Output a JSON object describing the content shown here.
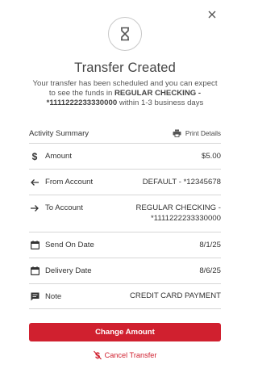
{
  "dialog": {
    "title": "Transfer Created",
    "desc_pre": "Your transfer has been scheduled and you can expect to see the funds in ",
    "desc_account": "REGULAR CHECKING - *1111222233330000",
    "desc_post": " within 1-3 business days"
  },
  "summary": {
    "title": "Activity Summary",
    "print_label": "Print Details",
    "rows": {
      "amount": {
        "label": "Amount",
        "value": "$5.00",
        "icon": "dollar-icon"
      },
      "from": {
        "label": "From Account",
        "value": "DEFAULT - *12345678",
        "icon": "arrow-left-icon"
      },
      "to": {
        "label": "To Account",
        "value_line1": "REGULAR CHECKING -",
        "value_line2": "*1111222233330000",
        "icon": "arrow-right-icon"
      },
      "send": {
        "label": "Send On Date",
        "value": "8/1/25",
        "icon": "calendar-icon"
      },
      "delivery": {
        "label": "Delivery Date",
        "value": "8/6/25",
        "icon": "calendar-icon"
      },
      "note": {
        "label": "Note",
        "value": "CREDIT CARD PAYMENT",
        "icon": "note-icon"
      }
    }
  },
  "actions": {
    "change_label": "Change Amount",
    "cancel_label": "Cancel Transfer"
  },
  "colors": {
    "accent": "#d0202f",
    "text": "#333333",
    "divider": "#d6d6d6"
  }
}
